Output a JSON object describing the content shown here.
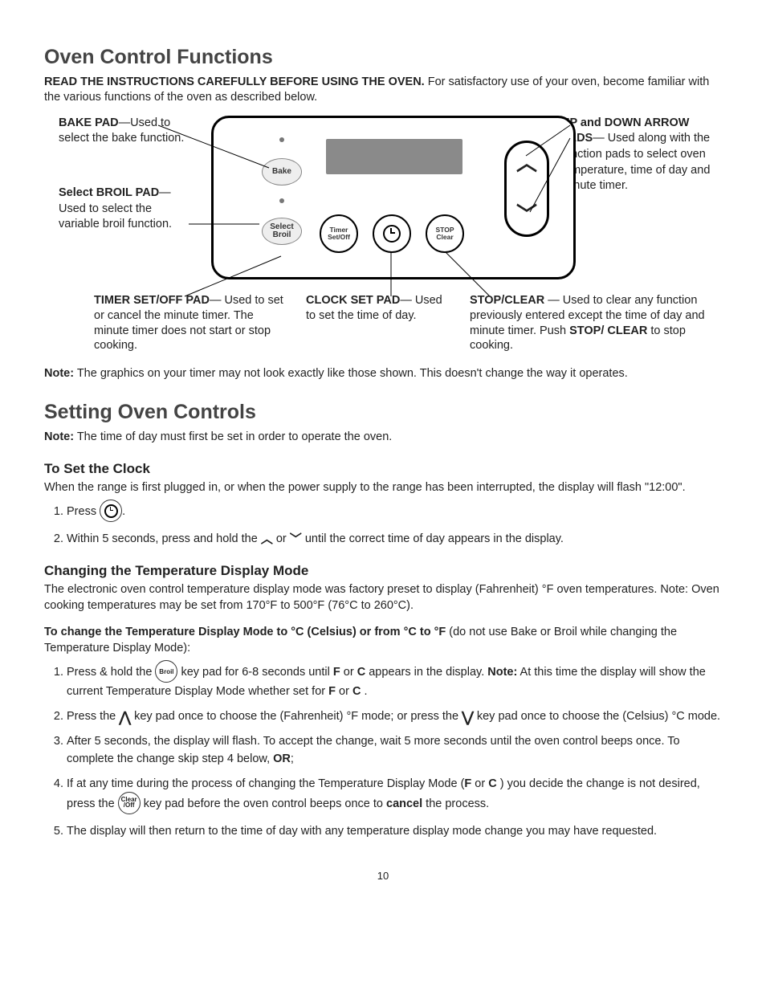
{
  "page_number": "10",
  "h1": "Oven Control Functions",
  "intro_bold": "READ THE INSTRUCTIONS CAREFULLY BEFORE USING THE OVEN.",
  "intro_rest": " For satisfactory use of your oven, become familiar with the various functions of the oven as described below.",
  "bake_callout_label": "BAKE PAD",
  "bake_callout_text": "—Used to select the bake function.",
  "broil_callout_label": "Select BROIL PAD",
  "broil_callout_text": "— Used to select the variable broil function.",
  "arrows_callout_label": "UP and DOWN ARROW PADS",
  "arrows_callout_text": "— Used along with the function pads to select oven temperature, time of day and minute timer.",
  "timer_callout_label": "TIMER SET/OFF PAD",
  "timer_callout_text": "— Used to set or cancel the minute timer. The minute timer does not start or stop cooking.",
  "clock_callout_label": "CLOCK SET PAD",
  "clock_callout_text": "— Used to set the time of day.",
  "stop_callout_label": "STOP/CLEAR",
  "stop_callout_text1": " — Used to clear any function previously entered except the time of day and minute timer. Push ",
  "stop_callout_bold2": "STOP/ CLEAR",
  "stop_callout_text2": " to stop cooking.",
  "pad_bake": "Bake",
  "pad_broil_1": "Select",
  "pad_broil_2": "Broil",
  "btn_timer_1": "Timer",
  "btn_timer_2": "Set/Off",
  "btn_stop_1": "STOP",
  "btn_stop_2": "Clear",
  "note1_label": "Note:",
  "note1_text": " The graphics on your timer may not look exactly like those shown. This doesn't change the way it operates.",
  "h2": "Setting Oven Controls",
  "note2_label": "Note:",
  "note2_text": " The time of day must first be set in order to operate the oven.",
  "h3a": "To Set the Clock",
  "clock_intro": "When the range is first plugged in, or when the power supply to the range has been interrupted, the display will flash \"12:00\".",
  "clock_step1_a": "Press ",
  "clock_step1_b": ".",
  "clock_step2_a": "Within 5 seconds, press and hold the ",
  "clock_step2_b": " or ",
  "clock_step2_c": " until the correct time of day appears in the display.",
  "h3b": "Changing the Temperature Display Mode",
  "temp_intro": "The electronic oven control temperature display mode was factory preset to display (Fahrenheit) °F oven temperatures. Note: Oven cooking temperatures may be set from 170°F to 500°F (76°C to 260°C).",
  "temp_lead_bold": "To change the Temperature Display Mode to °C (Celsius) or from °C to °F",
  "temp_lead_rest": " (do not use Bake or Broil while changing the Temperature Display Mode):",
  "t1a": "Press & hold the ",
  "t1b": " key pad for 6-8 seconds until ",
  "t1c": " or ",
  "t1d": " appears in the display. ",
  "t1e": " At this time the display will show the current Temperature Display Mode whether set for ",
  "t1f": " or ",
  "t1g": " .",
  "F": "F",
  "C": "C",
  "Note_colon": "Note:",
  "t2a": "Press the ",
  "t2b": " key pad once to choose the (Fahrenheit) °F mode; or press the ",
  "t2c": " key pad once to choose the (Celsius) °C mode.",
  "t3a": "After 5 seconds, the display will flash. To accept the change, wait 5 more seconds until the oven control beeps once. To complete the change skip step 4 below, ",
  "t3b": "OR",
  "t3c": ";",
  "t4a": "If at any time during the process of changing the Temperature Display Mode (",
  "t4b": " or ",
  "t4c": " ) you decide the change is not desired, press the ",
  "t4d": " key pad before the oven control beeps once to ",
  "t4e": "cancel",
  "t4f": " the process.",
  "t5": "The display will then return to the time of day with any temperature display mode change you may have requested.",
  "icon_broil": "Broil",
  "icon_clear_1": "Clear",
  "icon_clear_2": "/Off"
}
